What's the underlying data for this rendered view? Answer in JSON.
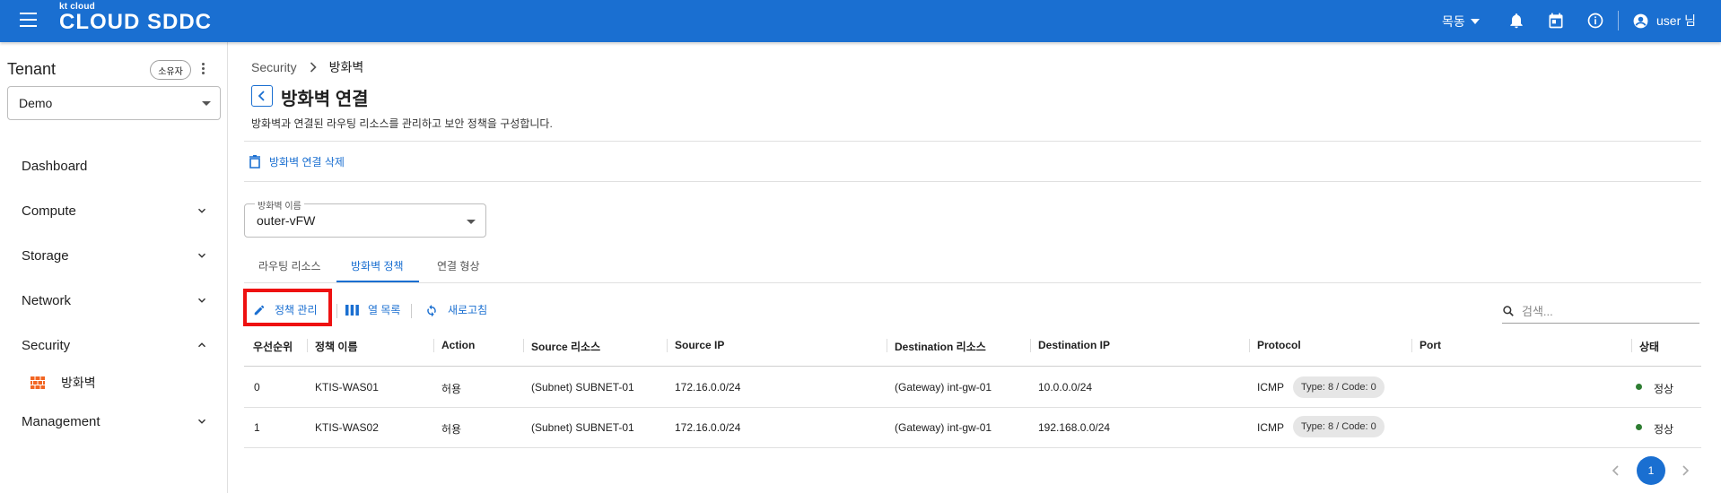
{
  "header": {
    "logo_small": "kt cloud",
    "logo_big": "CLOUD SDDC",
    "location": "목동",
    "user": "user 님"
  },
  "sidebar": {
    "tenant_title": "Tenant",
    "owner_chip": "소유자",
    "tenant_value": "Demo",
    "items": [
      {
        "label": "Dashboard"
      },
      {
        "label": "Compute"
      },
      {
        "label": "Storage"
      },
      {
        "label": "Network"
      },
      {
        "label": "Security"
      },
      {
        "label": "Management"
      }
    ],
    "sub_item": "방화벽"
  },
  "breadcrumb": {
    "parent": "Security",
    "current": "방화벽"
  },
  "page": {
    "title": "방화벽 연결",
    "description": "방화벽과 연결된 라우팅 리소스를 관리하고 보안 정책을 구성합니다.",
    "delete_label": "방화벽 연결 삭제"
  },
  "firewall_select": {
    "label": "방화벽 이름",
    "value": "outer-vFW"
  },
  "tabs": [
    {
      "label": "라우팅 리소스",
      "active": false
    },
    {
      "label": "방화벽 정책",
      "active": true
    },
    {
      "label": "연결 형상",
      "active": false
    }
  ],
  "toolbar": {
    "manage_policy": "정책 관리",
    "columns": "열 목록",
    "refresh": "새로고침",
    "search_placeholder": "검색..."
  },
  "table": {
    "headers": [
      "우선순위",
      "정책 이름",
      "Action",
      "Source 리소스",
      "Source IP",
      "Destination 리소스",
      "Destination IP",
      "Protocol",
      "Port",
      "상태"
    ],
    "rows": [
      {
        "priority": "0",
        "name": "KTIS-WAS01",
        "action": "허용",
        "src_res": "(Subnet) SUBNET-01",
        "src_ip": "172.16.0.0/24",
        "dst_res": "(Gateway) int-gw-01",
        "dst_ip": "10.0.0.0/24",
        "protocol": "ICMP",
        "port": "Type: 8 / Code: 0",
        "status": "정상"
      },
      {
        "priority": "1",
        "name": "KTIS-WAS02",
        "action": "허용",
        "src_res": "(Subnet) SUBNET-01",
        "src_ip": "172.16.0.0/24",
        "dst_res": "(Gateway) int-gw-01",
        "dst_ip": "192.168.0.0/24",
        "protocol": "ICMP",
        "port": "Type: 8 / Code: 0",
        "status": "정상"
      }
    ]
  },
  "pagination": {
    "current": "1"
  },
  "colors": {
    "accent": "#1a6fd1",
    "highlight": "#ee1111",
    "status_ok": "#2e7d32",
    "firewall_icon": "#f26522"
  },
  "icons": {
    "menu": "hamburger-icon",
    "bell": "bell-icon",
    "calendar": "calendar-icon",
    "info": "info-icon",
    "user": "account-icon",
    "firewall": "brick-wall-icon",
    "back": "chevron-left-icon",
    "delete": "trash-icon",
    "edit": "pencil-icon",
    "columns": "columns-icon",
    "refresh": "refresh-icon",
    "search": "search-icon"
  }
}
